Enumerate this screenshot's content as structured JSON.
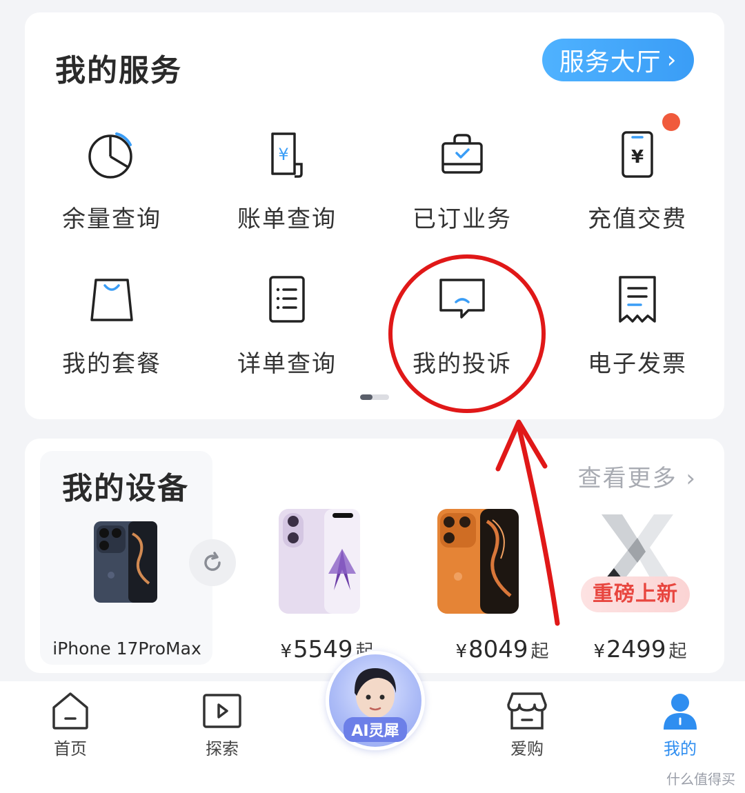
{
  "services": {
    "title": "我的服务",
    "hall_button": "服务大厅",
    "items": [
      {
        "label": "余量查询",
        "icon": "pie-chart-icon"
      },
      {
        "label": "账单查询",
        "icon": "bill-yuan-icon"
      },
      {
        "label": "已订业务",
        "icon": "subscribed-bag-icon"
      },
      {
        "label": "充值交费",
        "icon": "phone-yuan-icon",
        "badge": "red-dot"
      },
      {
        "label": "我的套餐",
        "icon": "shopping-bag-icon"
      },
      {
        "label": "详单查询",
        "icon": "list-document-icon"
      },
      {
        "label": "我的投诉",
        "icon": "complaint-chat-icon"
      },
      {
        "label": "电子发票",
        "icon": "receipt-icon"
      }
    ],
    "pager": {
      "current": 1,
      "total": 2
    }
  },
  "devices": {
    "title": "我的设备",
    "more_label": "查看更多",
    "featured": {
      "name": "iPhone 17ProMax"
    },
    "products": [
      {
        "currency": "¥",
        "price": "5549",
        "suffix": "起"
      },
      {
        "currency": "¥",
        "price": "8049",
        "suffix": "起"
      },
      {
        "currency": "¥",
        "price": "2499",
        "suffix": "起",
        "badge": "重磅上新"
      }
    ]
  },
  "ai": {
    "label": "AI灵犀"
  },
  "tabbar": {
    "tabs": [
      {
        "label": "首页",
        "icon": "home-icon",
        "active": false
      },
      {
        "label": "探索",
        "icon": "play-icon",
        "active": false
      },
      {
        "label": "爱购",
        "icon": "store-icon",
        "active": false
      },
      {
        "label": "我的",
        "icon": "profile-icon",
        "active": true
      }
    ]
  },
  "watermark": "什么值得买",
  "colors": {
    "accent": "#3a9df6",
    "badge_red": "#f05a3c",
    "annotation_red": "#e01818",
    "tab_active": "#2f8ef0"
  }
}
